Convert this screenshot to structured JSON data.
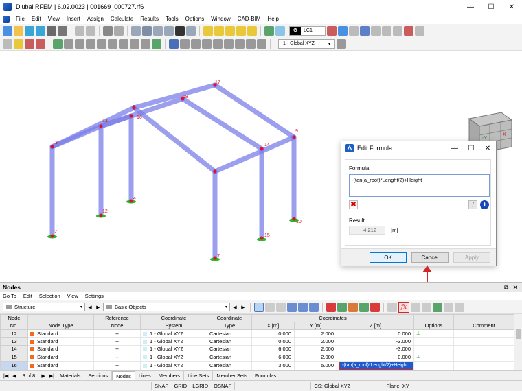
{
  "window": {
    "title": "Dlubal RFEM | 6.02.0023 | 001669_000727.rf6",
    "minimize": "—",
    "maximize": "☐",
    "close": "✕"
  },
  "menu": [
    "File",
    "Edit",
    "View",
    "Insert",
    "Assign",
    "Calculate",
    "Results",
    "Tools",
    "Options",
    "Window",
    "CAD-BIM",
    "Help"
  ],
  "toolbar": {
    "load_case_badge": "G",
    "load_case": "LC1",
    "view_combo": "1 - Global XYZ"
  },
  "model": {
    "node_labels": [
      "2",
      "3",
      "4",
      "5",
      "7",
      "9",
      "10",
      "12",
      "13",
      "14",
      "15",
      "16",
      "17",
      "18"
    ]
  },
  "nav_cube": {
    "axis_y": "-Y",
    "axis_x": "X"
  },
  "dialog": {
    "title": "Edit Formula",
    "formula_label": "Formula",
    "formula_value": "-(tan(a_roof)*Lenght/2)+Height",
    "delete_glyph": "✖",
    "info_glyph": "i",
    "fx_glyph": "ƒ",
    "result_label": "Result",
    "result_value": "-4.212",
    "result_unit": "[m]",
    "ok": "OK",
    "cancel": "Cancel",
    "apply": "Apply"
  },
  "panel": {
    "title": "Nodes",
    "menu": [
      "Go To",
      "Edit",
      "Selection",
      "View",
      "Settings"
    ],
    "structure_combo": "Structure",
    "objects_combo": "Basic Objects",
    "fx_label": "fx"
  },
  "table": {
    "headers_top": {
      "node": "Node",
      "ref": "Reference",
      "coord": "Coordinate",
      "coord_type": "Coordinate",
      "coordinates": "Coordinates"
    },
    "headers": {
      "no": "No.",
      "node_type": "Node Type",
      "ref_node": "Node",
      "coord_system": "System",
      "coord_type": "Type",
      "x": "X [m]",
      "y": "Y [m]",
      "z": "Z [m]",
      "options": "Options",
      "comment": "Comment"
    },
    "rows": [
      {
        "no": "12",
        "type": "Standard",
        "ref": "--",
        "system": "1 - Global XYZ",
        "ctype": "Cartesian",
        "x": "0.000",
        "y": "2.000",
        "z": "0.000",
        "support": "⊥"
      },
      {
        "no": "13",
        "type": "Standard",
        "ref": "--",
        "system": "1 - Global XYZ",
        "ctype": "Cartesian",
        "x": "0.000",
        "y": "2.000",
        "z": "-3.000",
        "support": ""
      },
      {
        "no": "14",
        "type": "Standard",
        "ref": "--",
        "system": "1 - Global XYZ",
        "ctype": "Cartesian",
        "x": "6.000",
        "y": "2.000",
        "z": "-3.000",
        "support": ""
      },
      {
        "no": "15",
        "type": "Standard",
        "ref": "--",
        "system": "1 - Global XYZ",
        "ctype": "Cartesian",
        "x": "6.000",
        "y": "2.000",
        "z": "0.000",
        "support": "⊥"
      },
      {
        "no": "16",
        "type": "Standard",
        "ref": "--",
        "system": "1 - Global XYZ",
        "ctype": "Cartesian",
        "x": "3.000",
        "y": "5.000",
        "z": "-(tan(a_roof)*Lenght/2)+Height",
        "support": ""
      }
    ]
  },
  "tabs": {
    "page": "3 of 8",
    "items": [
      "Materials",
      "Sections",
      "Nodes",
      "Lines",
      "Members",
      "Line Sets",
      "Member Sets",
      "Formulas"
    ],
    "active": "Nodes"
  },
  "status": {
    "items": [
      "SNAP",
      "GRID",
      "LGRID",
      "OSNAP"
    ],
    "cs": "CS: Global XYZ",
    "plane": "Plane: XY"
  },
  "colors": {
    "member": "#7b7fe8",
    "node": "#e0102a",
    "support": "#29b829",
    "node_type_swatch": "#f26b1d",
    "accent_red": "#d02828"
  }
}
